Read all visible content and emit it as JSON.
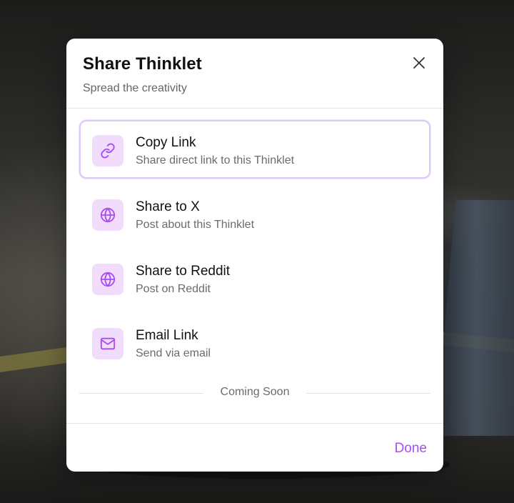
{
  "dialog": {
    "title": "Share Thinklet",
    "subtitle": "Spread the creativity"
  },
  "options": [
    {
      "title": "Copy Link",
      "description": "Share direct link to this Thinklet",
      "icon": "link-icon",
      "selected": true
    },
    {
      "title": "Share to X",
      "description": "Post about this Thinklet",
      "icon": "globe-icon",
      "selected": false
    },
    {
      "title": "Share to Reddit",
      "description": "Post on Reddit",
      "icon": "globe-icon",
      "selected": false
    },
    {
      "title": "Email Link",
      "description": "Send via email",
      "icon": "mail-icon",
      "selected": false
    }
  ],
  "section_divider": "Coming Soon",
  "footer": {
    "done_label": "Done"
  },
  "colors": {
    "accent": "#a84df0",
    "icon_bg": "#f1dcfb",
    "selected_border": "#ddc8f6"
  }
}
